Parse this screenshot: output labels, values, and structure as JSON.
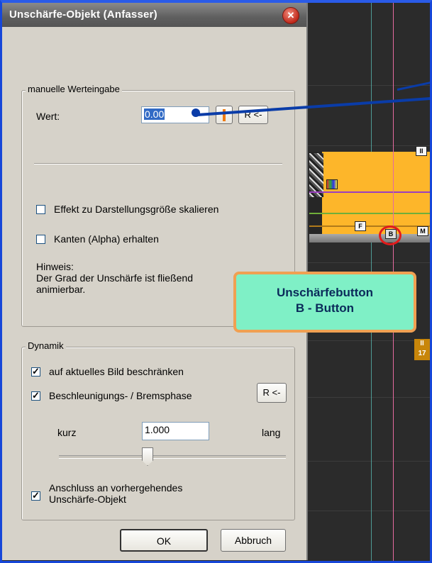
{
  "dialog": {
    "title": "Unschärfe-Objekt (Anfasser)",
    "close_glyph": "✕",
    "manual_group": {
      "title": "manuelle Werteingabe",
      "value_label": "Wert:",
      "value": "0.00",
      "reset_label": "R <-",
      "scale_checkbox": {
        "label": "Effekt zu Darstellungsgröße skalieren",
        "checked": false
      },
      "alpha_checkbox": {
        "label": "Kanten (Alpha) erhalten",
        "checked": false
      },
      "hint_title": "Hinweis:",
      "hint_line1": "Der Grad der Unschärfe ist fließend",
      "hint_line2": "animierbar."
    },
    "dynamics_group": {
      "title": "Dynamik",
      "restrict_checkbox": {
        "label": "auf aktuelles Bild beschränken",
        "checked": true
      },
      "accel_checkbox": {
        "label": "Beschleunigungs- / Bremsphase",
        "checked": true
      },
      "reset_label": "R <-",
      "short_label": "kurz",
      "long_label": "lang",
      "value": "1.000",
      "connect_checkbox": {
        "label_line1": "Anschluss an vorhergehendes",
        "label_line2": "Unschärfe-Objekt",
        "checked": true
      }
    },
    "ok_label": "OK",
    "cancel_label": "Abbruch"
  },
  "timeline": {
    "marker_top": "II",
    "marker_f": "F",
    "marker_b": "B",
    "marker_m": "M",
    "marker_bottom_line1": "II",
    "marker_bottom_line2": "17"
  },
  "callout": {
    "line1": "Unschärfebutton",
    "line2": "B - Button"
  },
  "icons": {
    "close": "close-icon",
    "color_picker": "orange-bar-icon",
    "checkmark": "check-icon"
  },
  "colors": {
    "track": "#fdb62a",
    "callout_bg": "#7ff0c6",
    "callout_border": "#f0a052",
    "highlight_circle": "#e21b1b",
    "frame_border": "#1747d9"
  }
}
